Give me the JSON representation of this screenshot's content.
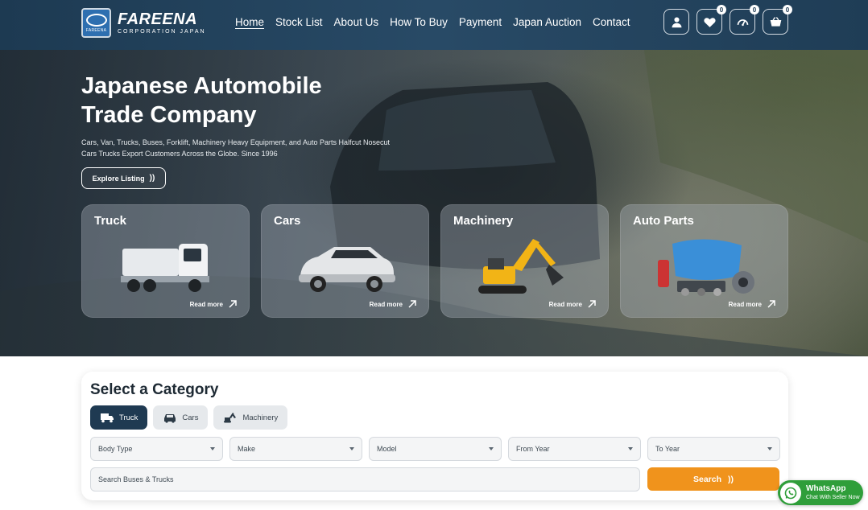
{
  "brand": {
    "name": "FAREENA",
    "tagline": "CORPORATION JAPAN",
    "badge_text": "FAREENA"
  },
  "nav": [
    {
      "label": "Home",
      "active": true
    },
    {
      "label": "Stock List"
    },
    {
      "label": "About Us"
    },
    {
      "label": "How To Buy"
    },
    {
      "label": "Payment"
    },
    {
      "label": "Japan Auction"
    },
    {
      "label": "Contact"
    }
  ],
  "header_icons": [
    {
      "icon": "user-icon"
    },
    {
      "icon": "heart-icon",
      "count": "0"
    },
    {
      "icon": "speedometer-icon",
      "count": "0"
    },
    {
      "icon": "cart-icon",
      "count": "0"
    }
  ],
  "hero": {
    "title": "Japanese Automobile Trade Company",
    "description": "Cars, Van, Trucks, Buses, Forklift, Machinery Heavy Equipment, and Auto Parts Halfcut Nosecut Cars Trucks Export Customers Across the Globe. Since 1996",
    "cta_label": "Explore Listing",
    "cta_arrow": "))"
  },
  "categories": [
    {
      "title": "Truck",
      "read_more": "Read more"
    },
    {
      "title": "Cars",
      "read_more": "Read more"
    },
    {
      "title": "Machinery",
      "read_more": "Read more"
    },
    {
      "title": "Auto Parts",
      "read_more": "Read more"
    }
  ],
  "search": {
    "title": "Select a Category",
    "tabs": [
      {
        "label": "Truck",
        "active": true,
        "icon": "truck-icon"
      },
      {
        "label": "Cars",
        "icon": "car-icon"
      },
      {
        "label": "Machinery",
        "icon": "excavator-icon"
      }
    ],
    "selects": [
      "Body Type",
      "Make",
      "Model",
      "From Year",
      "To Year"
    ],
    "input_placeholder": "Search Buses & Trucks",
    "button_label": "Search",
    "button_arrow": "))"
  },
  "whatsapp": {
    "title": "WhatsApp",
    "subtitle": "Chat With Seller Now"
  },
  "colors": {
    "header_bg": "#1d3a52",
    "accent_orange": "#f0931c",
    "active_tab": "#1f3a52",
    "whatsapp_green": "#2f9e3a"
  }
}
